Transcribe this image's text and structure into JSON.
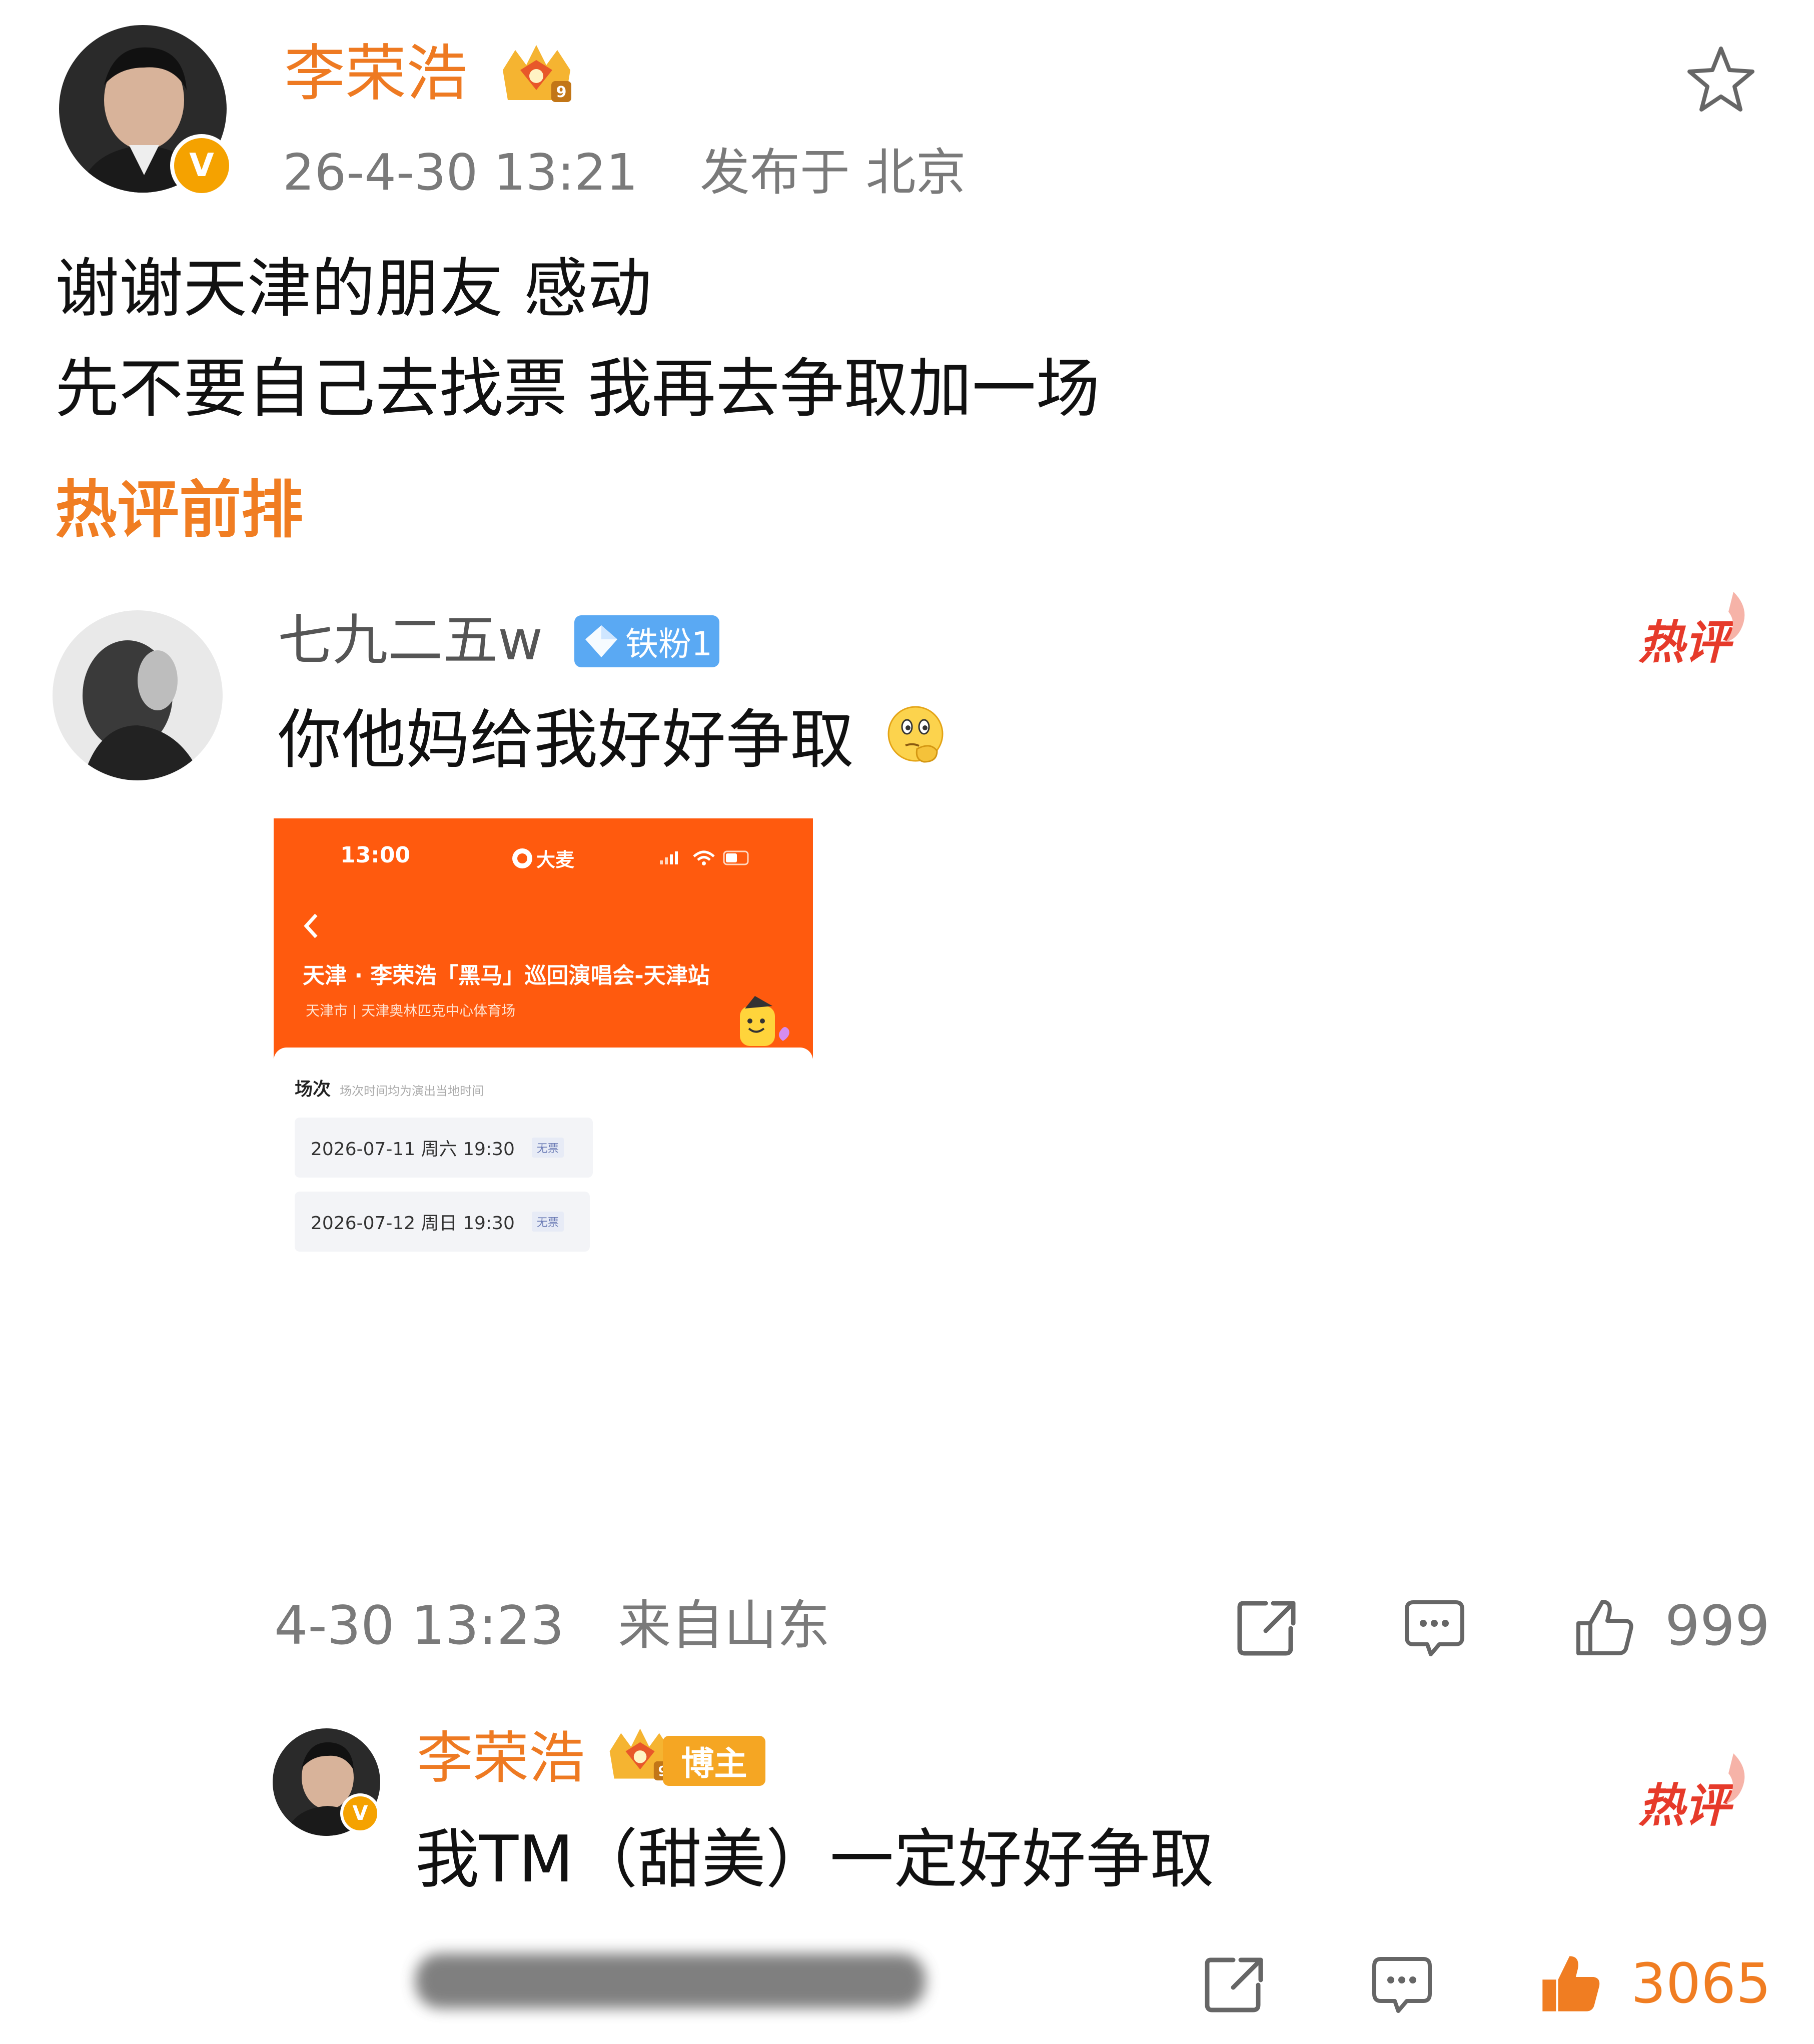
{
  "post": {
    "author": "李荣浩",
    "time": "26-4-30 13:21",
    "location": "发布于 北京",
    "lines": [
      "谢谢天津的朋友 感动",
      "先不要自己去找票 我再去争取加一场"
    ],
    "favorite_icon": "star-outline-icon",
    "crown_level": "9"
  },
  "hot_section": {
    "title": "热评前排"
  },
  "comment": {
    "author": "七九二五w",
    "fan_badge": "铁粉1",
    "text": "你他妈给我好好争取",
    "emoji_icon": "thinking-face-icon",
    "hot_label": "热评",
    "time": "4-30 13:23",
    "location": "来自山东",
    "likes": "999"
  },
  "screenshot": {
    "status_time": "13:00",
    "app_name": "大麦",
    "title": "天津 · 李荣浩「黑马」巡回演唱会-天津站",
    "venue": "天津市 | 天津奥林匹克中心体育场",
    "section_label": "场次",
    "section_hint": "场次时间均为演出当地时间",
    "sessions": [
      {
        "date": "2026-07-11  周六 19:30",
        "status": "无票"
      },
      {
        "date": "2026-07-12  周日 19:30",
        "status": "无票"
      }
    ]
  },
  "reply": {
    "author": "李荣浩",
    "role_badge": "博主",
    "crown_level": "9",
    "text": "我TM（甜美）一定好好争取",
    "hot_label": "热评",
    "likes": "3065"
  },
  "colors": {
    "brand_orange": "#ee7a22",
    "hot_red": "#e63a2a",
    "fan_blue": "#5aa9f3",
    "damai_orange": "#ff5a0e",
    "like_active": "#f07d22"
  }
}
